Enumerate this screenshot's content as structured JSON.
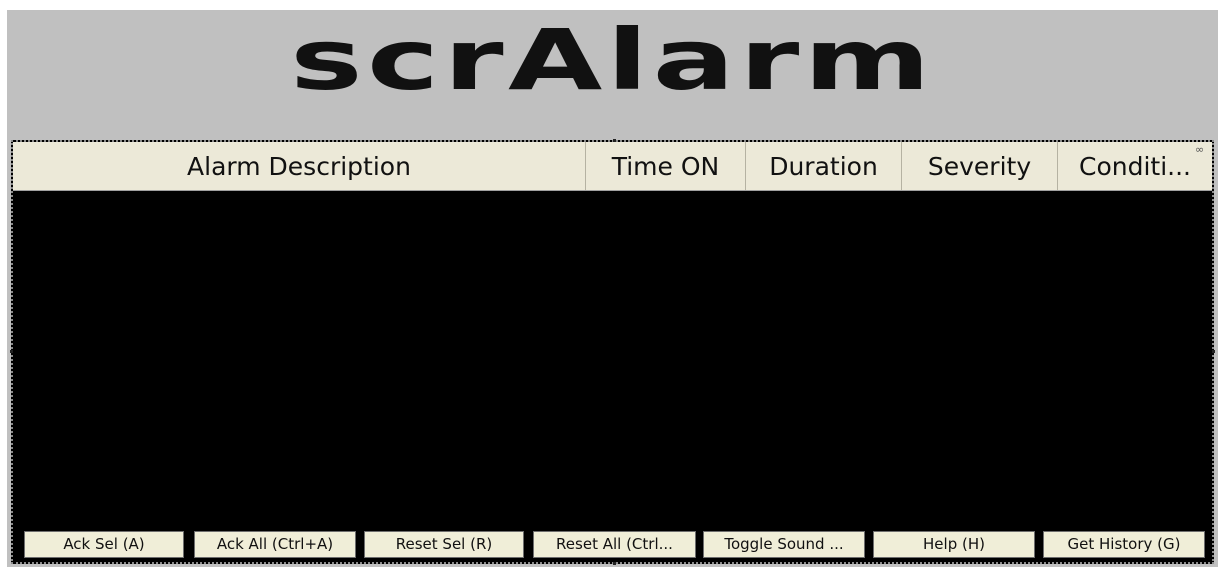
{
  "title": "scrAlarm",
  "table": {
    "columns": [
      "Alarm Description",
      "Time ON",
      "Duration",
      "Severity",
      "Conditi..."
    ]
  },
  "buttons": [
    "Ack Sel (A)",
    "Ack All (Ctrl+A)",
    "Reset Sel (R)",
    "Reset All (Ctrl...",
    "Toggle Sound ...",
    "Help (H)",
    "Get History (G)"
  ]
}
